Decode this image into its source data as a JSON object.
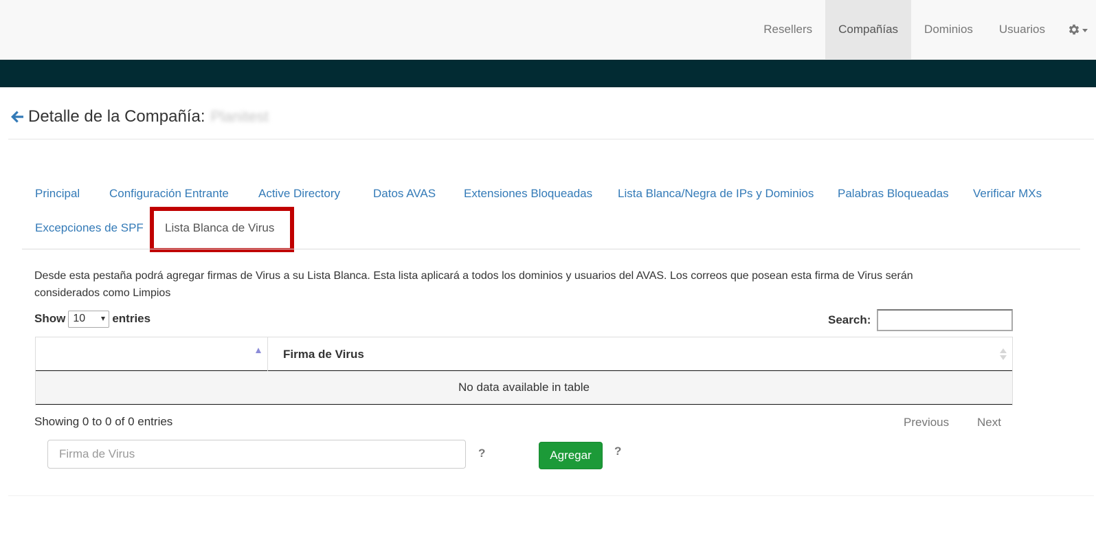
{
  "navbar": {
    "items": [
      {
        "label": "Resellers",
        "active": false
      },
      {
        "label": "Compañías",
        "active": true
      },
      {
        "label": "Dominios",
        "active": false
      },
      {
        "label": "Usuarios",
        "active": false
      }
    ],
    "settings_icon": "gear-icon",
    "bg_color": "#f8f8f8",
    "accent_bar_color": "#022b33"
  },
  "heading": {
    "back_icon": "arrow-left-icon",
    "title": "Detalle de la Compañía:",
    "company_name": "Planitest"
  },
  "tabs": [
    {
      "label": "Principal",
      "active": false
    },
    {
      "label": "Configuración Entrante",
      "active": false
    },
    {
      "label": "Active Directory",
      "active": false
    },
    {
      "label": "Datos AVAS",
      "active": false
    },
    {
      "label": "Extensiones Bloqueadas",
      "active": false
    },
    {
      "label": "Lista Blanca/Negra de IPs y Dominios",
      "active": false
    },
    {
      "label": "Palabras Bloqueadas",
      "active": false
    },
    {
      "label": "Verificar MXs",
      "active": false
    },
    {
      "label": "Excepciones de SPF",
      "active": false
    },
    {
      "label": "Lista Blanca de Virus",
      "active": true
    }
  ],
  "highlight_color": "#c00000",
  "description_line1": "Desde esta pestaña podrá agregar firmas de Virus a su Lista Blanca. Esta lista aplicará a todos los dominios y usuarios del AVAS. Los correos que posean esta firma de Virus serán",
  "description_line2": "considerados como Limpios",
  "length_menu": {
    "prefix": "Show",
    "selected": "10",
    "suffix": "entries"
  },
  "search": {
    "label": "Search:",
    "value": ""
  },
  "table": {
    "columns": [
      "",
      "Firma de Virus"
    ],
    "empty_message": "No data available in table"
  },
  "info": "Showing 0 to 0 of 0 entries",
  "pagination": {
    "previous": "Previous",
    "next": "Next"
  },
  "add_form": {
    "placeholder": "Firma de Virus",
    "help": "?",
    "button_label": "Agregar",
    "button_color": "#1c9a38"
  }
}
